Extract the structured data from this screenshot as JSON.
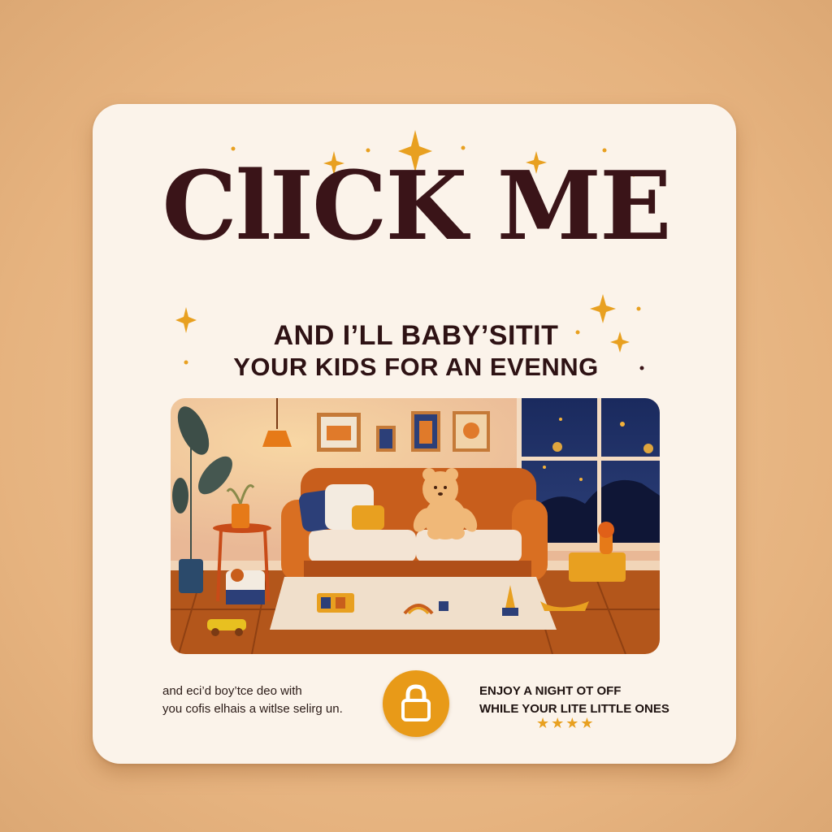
{
  "headline": "ClICK ME",
  "subheadline_line1": "AND I’LL BABY’SITIT",
  "subheadline_line2": "YOUR KIDS FOR AN EVENNG",
  "footer_left": {
    "line1": "and eci’d boy’tce deo with",
    "line2": "you cofis elhais a witlse selirg un."
  },
  "footer_right": {
    "line1": "ENJOY A NIGHT OT OFF",
    "line2": "WHILE YOUR LITE LITTLE ONES"
  },
  "rating_stars": "★★★★",
  "rating_value": 4,
  "button_icon": "lock-icon",
  "colors": {
    "background": "#e9b987",
    "card": "#fbf3ea",
    "headline": "#3a1418",
    "accent": "#e89a18",
    "sofa": "#c85e1c",
    "floor": "#b0561c",
    "night_sky": "#1c2a5c"
  }
}
